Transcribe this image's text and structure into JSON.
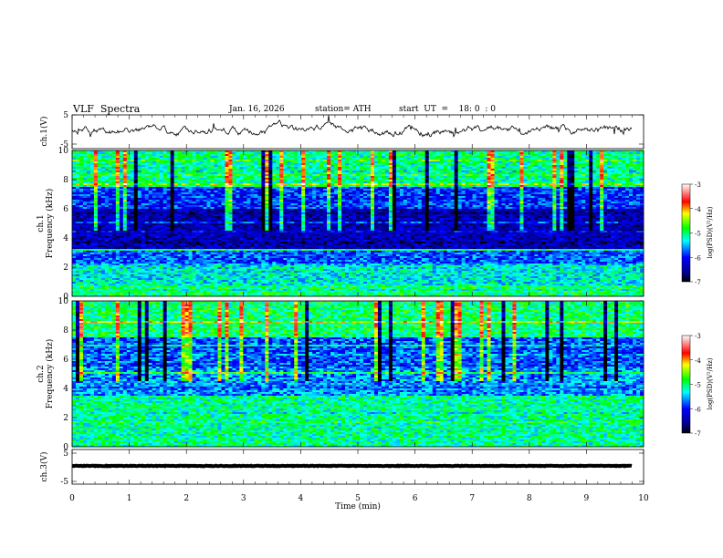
{
  "header": {
    "title": "VLF  Spectra",
    "date": "Jan. 16, 2026",
    "station": "station= ATH",
    "start": "start  UT  =    18: 0  : 0"
  },
  "chart_data": [
    {
      "type": "line",
      "ylabel": "ch.1(V)",
      "ylim": [
        -5,
        5
      ],
      "yticks": [
        "5",
        "-5"
      ],
      "xlim": [
        0,
        10
      ],
      "description_series": "waveform"
    },
    {
      "type": "heatmap",
      "ylabel": "ch.1\nFrequency (kHz)",
      "ylim": [
        0,
        10
      ],
      "yticks": [
        "0",
        "2",
        "4",
        "6",
        "8",
        "10"
      ],
      "xlim": [
        0,
        10
      ],
      "colorbar": {
        "label": "log(PSD)(V²/Hz)",
        "range": [
          -7,
          -3
        ],
        "ticks": [
          "-3",
          "-4",
          "-5",
          "-6",
          "-7"
        ]
      }
    },
    {
      "type": "heatmap",
      "ylabel": "ch.2\nFrequency (kHz)",
      "ylim": [
        0,
        10
      ],
      "yticks": [
        "0",
        "2",
        "4",
        "6",
        "8",
        "10"
      ],
      "xlim": [
        0,
        10
      ],
      "colorbar": {
        "label": "log(PSD)(V²/Hz)",
        "range": [
          -7,
          -3
        ],
        "ticks": [
          "-3",
          "-4",
          "-5",
          "-6",
          "-7"
        ]
      }
    },
    {
      "type": "line",
      "ylabel": "ch.3(V)",
      "ylim": [
        -5,
        5
      ],
      "yticks": [
        "5",
        "-5"
      ],
      "xlim": [
        0,
        10
      ],
      "xlabel": "Time  (min)",
      "xticks": [
        "0",
        "1",
        "2",
        "3",
        "4",
        "5",
        "6",
        "7",
        "8",
        "9",
        "10"
      ]
    }
  ],
  "ylabels": {
    "ch1v": "ch.1(V)",
    "ch1f_a": "ch.1",
    "ch1f_b": "Frequency  (kHz)",
    "ch2f_a": "ch.2",
    "ch2f_b": "Frequency  (kHz)",
    "ch3v": "ch.3(V)",
    "cbar": "log(PSD)(V²/Hz)"
  },
  "xlabel": "Time  (min)",
  "xticks": [
    "0",
    "1",
    "2",
    "3",
    "4",
    "5",
    "6",
    "7",
    "8",
    "9",
    "10"
  ],
  "vticks": [
    "5",
    "-5"
  ],
  "fticks": [
    "0",
    "2",
    "4",
    "6",
    "8",
    "10"
  ],
  "cticks": [
    "-3",
    "-4",
    "-5",
    "-6",
    "-7"
  ],
  "colors": {
    "deep": "#000050",
    "blue": "#0000ff",
    "cyan": "#00ffff",
    "green": "#00ff00",
    "yellow": "#ffff00",
    "red": "#ff0000",
    "white": "#ffffff"
  }
}
